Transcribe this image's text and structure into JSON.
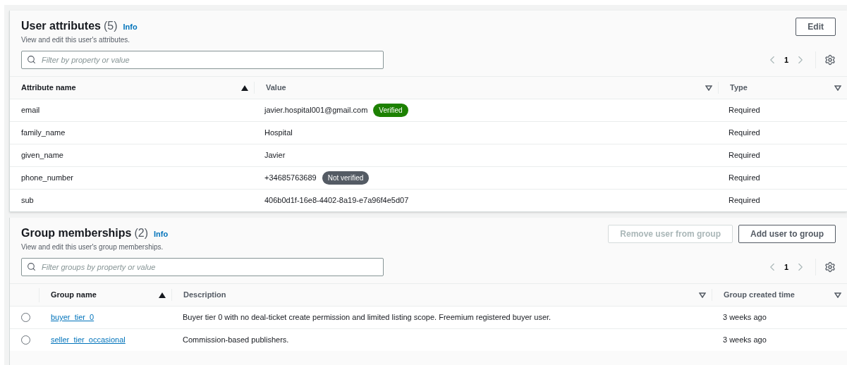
{
  "attributes": {
    "title": "User attributes",
    "count": "(5)",
    "info": "Info",
    "description": "View and edit this user's attributes.",
    "buttons": [
      {
        "label": "Edit",
        "disabled": false
      }
    ],
    "filter": {
      "placeholder": "Filter by property or value"
    },
    "page": "1",
    "columns": [
      {
        "label": "Attribute name",
        "sorted": true
      },
      {
        "label": "Value",
        "sorted": false
      },
      {
        "label": "Type",
        "sorted": false
      }
    ],
    "rows": [
      {
        "name": "email",
        "value": "javier.hospital001@gmail.com",
        "badge": {
          "text": "Verified",
          "kind": "success"
        },
        "type": "Required"
      },
      {
        "name": "family_name",
        "value": "Hospital",
        "type": "Required"
      },
      {
        "name": "given_name",
        "value": "Javier",
        "type": "Required"
      },
      {
        "name": "phone_number",
        "value": "+34685763689",
        "badge": {
          "text": "Not verified",
          "kind": "neutral"
        },
        "type": "Required"
      },
      {
        "name": "sub",
        "value": "406b0d1f-16e8-4402-8a19-e7a96f4e5d07",
        "type": "Required"
      }
    ]
  },
  "groups": {
    "title": "Group memberships",
    "count": "(2)",
    "info": "Info",
    "description": "View and edit this user's group memberships.",
    "buttons": [
      {
        "label": "Remove user from group",
        "disabled": true
      },
      {
        "label": "Add user to group",
        "disabled": false
      }
    ],
    "filter": {
      "placeholder": "Filter groups by property or value"
    },
    "page": "1",
    "columns": [
      {
        "label": "Group name",
        "sorted": true
      },
      {
        "label": "Description",
        "sorted": false
      },
      {
        "label": "Group created time",
        "sorted": false
      }
    ],
    "rows": [
      {
        "name": "buyer_tier_0",
        "description": "Buyer tier 0 with no deal-ticket create permission and limited listing scope. Freemium registered buyer user.",
        "created": "3 weeks ago",
        "selected": false
      },
      {
        "name": "seller_tier_occasional",
        "description": "Commission-based publishers.",
        "created": "3 weeks ago",
        "selected": false
      }
    ]
  }
}
